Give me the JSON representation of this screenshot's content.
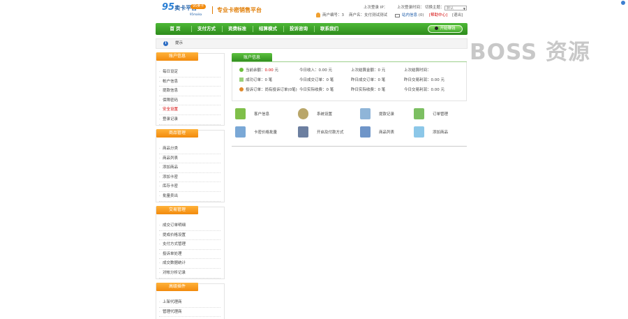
{
  "header": {
    "logo_number": "95",
    "logo_text": "卖卡平台",
    "logo_badge": "95卖卡",
    "logo_sub": "95maika",
    "slogan": "专业卡密销售平台",
    "last_login_ip_label": "上次登录 IP：",
    "last_login_time_label": "上次登录时间：",
    "switch_label": "切换主题：",
    "theme_select_value": "默认",
    "user_id_label": "商户编号：",
    "user_id_value": "3",
    "user_name_label": "商户名：",
    "user_name_value": "支付测试测试",
    "message_label": "站内信息",
    "message_count": "(0)",
    "help_label": "[帮助中心]",
    "logout_label": "[退出]"
  },
  "nav": {
    "items": [
      "首 页",
      "支付方式",
      "资费标准",
      "结算模式",
      "投诉咨询",
      "联系我们"
    ],
    "open_shop": "开始赚钱"
  },
  "breadcrumb": {
    "text": "提示"
  },
  "sidebar": [
    {
      "title": "账户信息",
      "items": [
        "每日设定",
        "帐户信息",
        "提款信息",
        "保障密码",
        "安全设置",
        "登录记录"
      ],
      "active": 4
    },
    {
      "title": "商品管理",
      "items": [
        "商品分类",
        "商品列表",
        "添加商品",
        "添加卡密",
        "库存卡密",
        "批量卖出"
      ]
    },
    {
      "title": "交易管理",
      "items": [
        "成交订单明细",
        "提成价格设置",
        "支付方式管理",
        "投诉单处理",
        "成交数据统计",
        "对帐分析记录"
      ]
    },
    {
      "title": "高级插件",
      "items": [
        "上架代理商",
        "管理代理商"
      ]
    }
  ],
  "account": {
    "tab_label": "账户信息",
    "rows": [
      [
        {
          "label": "当前余额：",
          "value": "0.00",
          "unit": "元",
          "icon_color": "#6cbf3c"
        },
        {
          "label": "今日收入：",
          "value": "0.00",
          "unit": "元"
        },
        {
          "label": "上次结算金额：",
          "value": "0",
          "unit": "元"
        },
        {
          "label": "上次结算时间：",
          "value": "",
          "unit": ""
        }
      ],
      [
        {
          "label": "成功订单：",
          "value": "0",
          "unit": "笔",
          "icon_color": "#9ad07a"
        },
        {
          "label": "今日成交订单：",
          "value": "0",
          "unit": "笔"
        },
        {
          "label": "昨日成交订单：",
          "value": "0",
          "unit": "笔"
        },
        {
          "label": "昨日交易利润：",
          "value": "0.00",
          "unit": "元"
        }
      ],
      [
        {
          "label": "投诉订单：",
          "value": "尚有投诉订单(0笔)",
          "unit": "",
          "icon_color": "#e08a2c"
        },
        {
          "label": "今日实际收费：",
          "value": "0",
          "unit": "笔"
        },
        {
          "label": "昨日实际收费：",
          "value": "0",
          "unit": "笔"
        },
        {
          "label": "今日交易利润：",
          "value": "0.00",
          "unit": "元"
        }
      ]
    ]
  },
  "quick_links": [
    {
      "label": "客户信息",
      "icon": "user-card-icon",
      "color": "#7fbf4a"
    },
    {
      "label": "系统设置",
      "icon": "gear-icon",
      "color": "#b9a66a"
    },
    {
      "label": "提款记录",
      "icon": "download-doc-icon",
      "color": "#8fb5d8"
    },
    {
      "label": "订单管理",
      "icon": "order-doc-icon",
      "color": "#7cbf62"
    },
    {
      "label": "卡密价格批量",
      "icon": "card-edit-icon",
      "color": "#7aa8d6"
    },
    {
      "label": "开启及付款方式",
      "icon": "card-pay-icon",
      "color": "#6c7fa0"
    },
    {
      "label": "商品列表",
      "icon": "product-star-icon",
      "color": "#6f95c8"
    },
    {
      "label": "添加商品",
      "icon": "add-product-icon",
      "color": "#8cc7e8"
    }
  ],
  "watermark": "BOSS 资源"
}
